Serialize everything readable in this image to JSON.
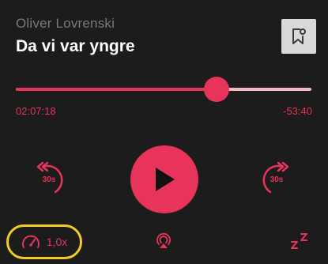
{
  "book": {
    "author": "Oliver Lovrenski",
    "title": "Da vi var yngre"
  },
  "progress": {
    "fraction": 0.68,
    "elapsed": "02:07:18",
    "remaining": "-53:40"
  },
  "controls": {
    "skip_back_label": "30s",
    "skip_forward_label": "30s",
    "speed_label": "1,0x"
  },
  "colors": {
    "accent": "#e8335b",
    "track": "#f4b7c4",
    "highlight": "#f2cc1f",
    "background": "#1c1c1c"
  },
  "icons": [
    "bookmark-icon",
    "rewind-icon",
    "play-icon",
    "forward-icon",
    "speedometer-icon",
    "airplay-icon",
    "sleep-timer-icon"
  ]
}
